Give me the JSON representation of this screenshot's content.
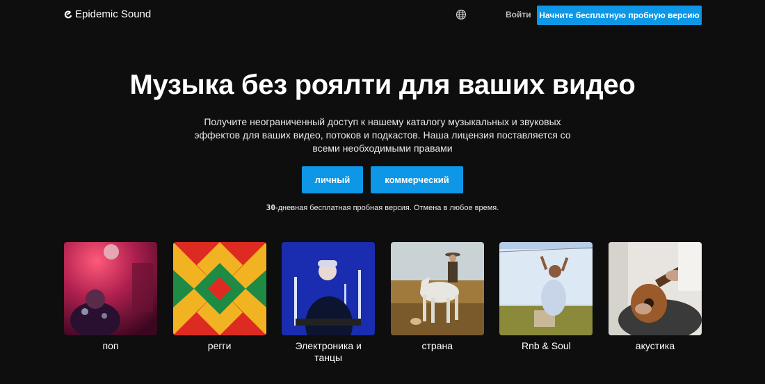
{
  "header": {
    "brand": "Epidemic Sound",
    "language_icon": "globe-icon",
    "login_label": "Войти",
    "trial_button_label": "Начните бесплатную пробную версию"
  },
  "hero": {
    "title": "Музыка без роялти для ваших видео",
    "subtitle": "Получите неограниченный доступ к нашему каталогу музыкальных и звуковых эффектов для ваших видео, потоков и подкастов. Наша лицензия поставляется со всеми необходимыми правами",
    "personal_label": "личный",
    "commercial_label": "коммерческий",
    "trial_days": "30",
    "trial_note_rest": "-дневная бесплатная пробная версия. Отмена в любое время."
  },
  "genres": [
    {
      "label": "поп"
    },
    {
      "label": "регги"
    },
    {
      "label": "Электроника и танцы"
    },
    {
      "label": "страна"
    },
    {
      "label": "Rnb & Soul"
    },
    {
      "label": "акустика"
    }
  ],
  "colors": {
    "background": "#0e0e0e",
    "accent": "#0d97e6"
  }
}
